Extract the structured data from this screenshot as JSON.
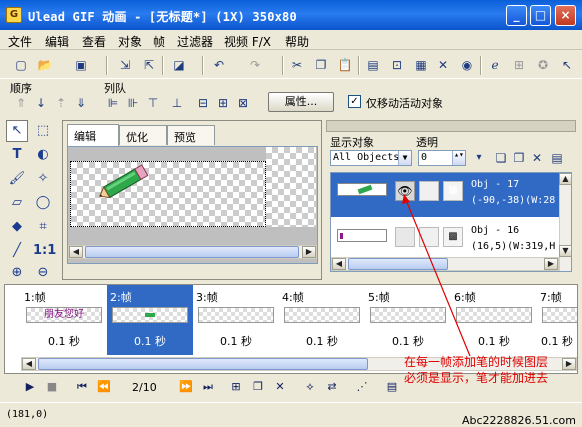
{
  "window": {
    "title": "Ulead GIF 动画 - [无标题*] (1X) 350x80",
    "minimize": "_",
    "maximize": "□",
    "close": "×"
  },
  "menu": [
    "文件",
    "编辑",
    "查看",
    "对象",
    "帧",
    "过滤器",
    "视频 F/X",
    "帮助"
  ],
  "toolbar2": {
    "order_label": "顺序",
    "align_label": "列队",
    "properties_button": "属性...",
    "move_active_label": "仅移动活动对象",
    "move_active_checked": "✓"
  },
  "tabs": [
    "编辑",
    "优化",
    "预览"
  ],
  "objects": {
    "display_label": "显示对象",
    "opacity_label": "透明",
    "filter_value": "All Objects",
    "opacity_value": "0",
    "rows": [
      {
        "name": "Obj - 17",
        "info": "(-90,-38)(W:28"
      },
      {
        "name": "Obj - 16",
        "info": "(16,5)(W:319,H"
      }
    ]
  },
  "frames": [
    {
      "label": "1:帧",
      "delay": "0.1 秒",
      "thumb_text": "朋友您好"
    },
    {
      "label": "2:帧",
      "delay": "0.1 秒",
      "thumb_text": ""
    },
    {
      "label": "3:帧",
      "delay": "0.1 秒",
      "thumb_text": ""
    },
    {
      "label": "4:帧",
      "delay": "0.1 秒",
      "thumb_text": ""
    },
    {
      "label": "5:帧",
      "delay": "0.1 秒",
      "thumb_text": ""
    },
    {
      "label": "6:帧",
      "delay": "0.1 秒",
      "thumb_text": ""
    },
    {
      "label": "7:帧",
      "delay": "0.1 秒",
      "thumb_text": ""
    }
  ],
  "playback": {
    "frame_counter": "2/10"
  },
  "status": {
    "cursor_pos": "(181,0)",
    "watermark": "Abc2228826.51.com"
  },
  "annotation": "在每一帧添加笔的时候图层必须是显示，笔才能加进去",
  "colors": {
    "selection": "#316ac5",
    "annotation": "#e00000",
    "titlebar": "#0a5fd8"
  }
}
